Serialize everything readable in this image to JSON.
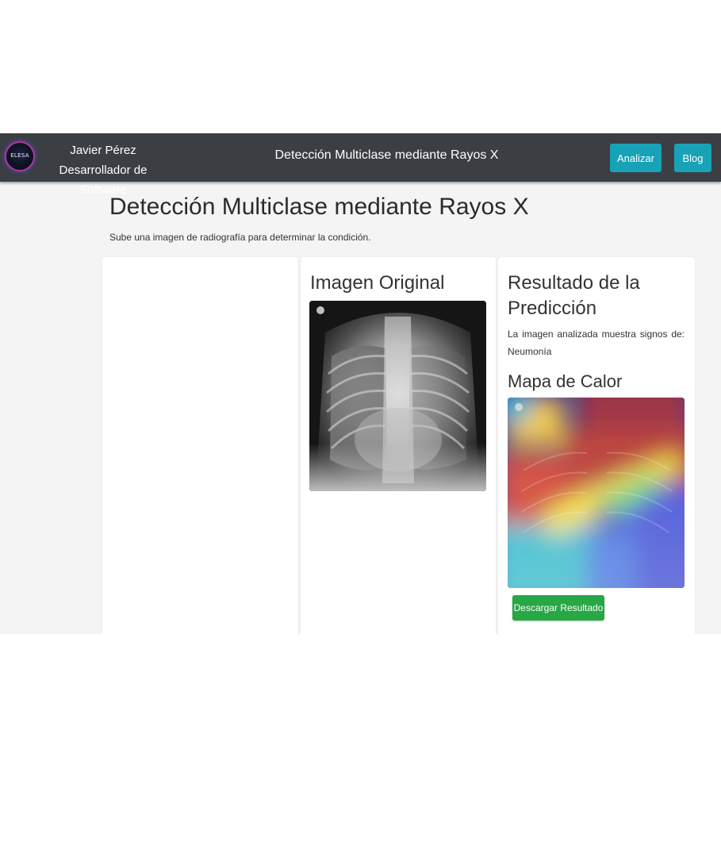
{
  "header": {
    "logo_text": "ELESA",
    "name": "Javier Pérez",
    "role": "Desarrollador de Software",
    "title": "Detección Multiclase mediante Rayos X",
    "buttons": {
      "analyze": "Analizar",
      "blog": "Blog"
    }
  },
  "main": {
    "heading": "Detección Multiclase mediante Rayos X",
    "subheading": "Sube una imagen de radiografía para determinar la condición."
  },
  "original_card": {
    "title": "Imagen Original"
  },
  "result_card": {
    "title": "Resultado de la Predicción",
    "message": "La imagen analizada muestra signos de:",
    "condition": "Neumonía",
    "heatmap_title": "Mapa de Calor",
    "download_label": "Descargar Resultado"
  },
  "colors": {
    "navbar": "#3b3e42",
    "accent": "#17a2b8",
    "success": "#28a745",
    "page_bg": "#f4f4f5"
  }
}
